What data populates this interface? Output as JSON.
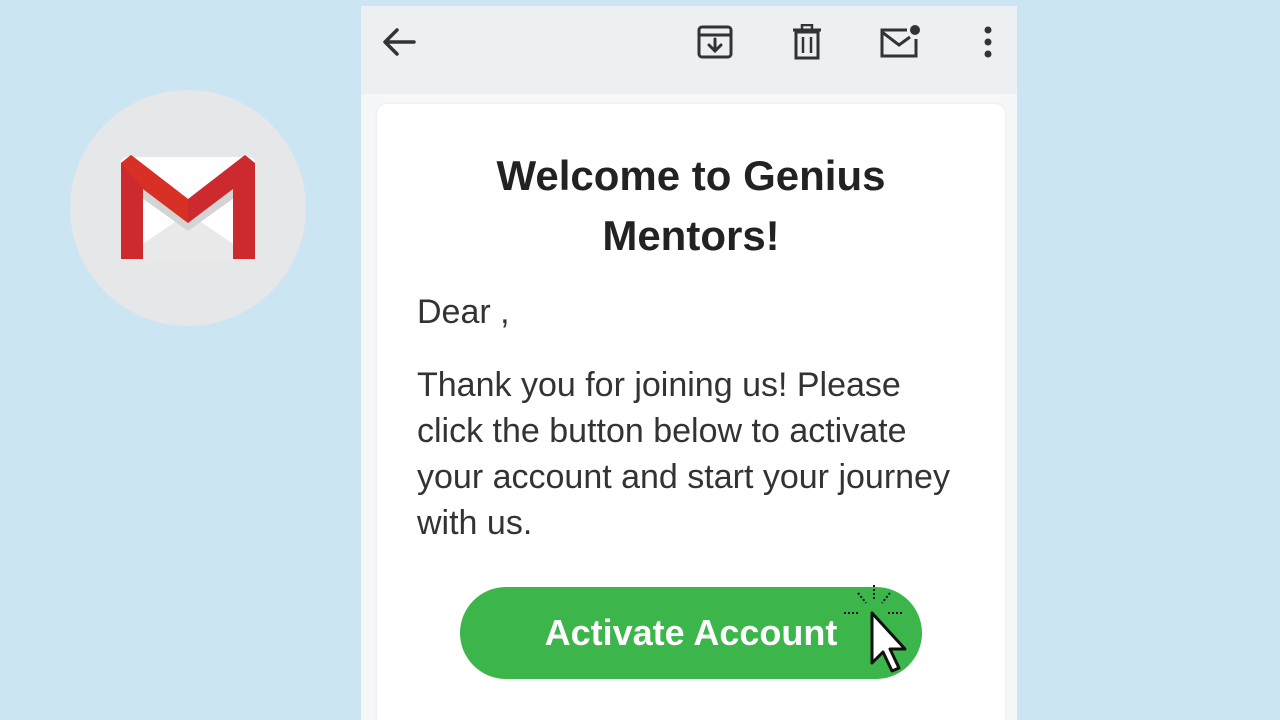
{
  "toolbar": {
    "back_icon": "arrow-left-icon",
    "actions": [
      "archive-icon",
      "trash-icon",
      "mark-unread-icon",
      "more-vert-icon"
    ]
  },
  "email": {
    "title": "Welcome to Genius Mentors!",
    "greeting": "Dear ,",
    "body": "Thank you for joining us! Please click the button below to activate your account and start your journey with us.",
    "button_label": "Activate Account"
  },
  "colors": {
    "background": "#cce5f2",
    "button": "#3cb54a",
    "gmail_red": "#d93025"
  },
  "logo": "gmail-logo-icon"
}
